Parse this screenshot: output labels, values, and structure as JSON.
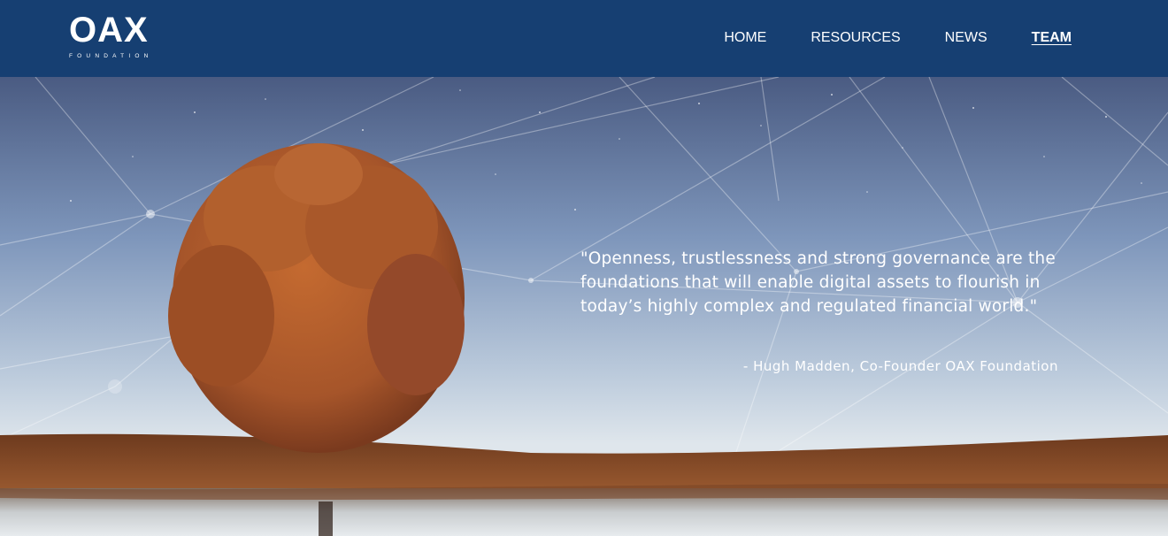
{
  "brand": {
    "logo_text": "OAX",
    "logo_subtext": "FOUNDATION"
  },
  "nav": {
    "items": [
      {
        "label": "HOME"
      },
      {
        "label": "RESOURCES"
      },
      {
        "label": "NEWS"
      },
      {
        "label": "TEAM",
        "active": true
      }
    ]
  },
  "hero": {
    "quote": "\"Openness, trustlessness and strong governance are the foundations that will enable digital assets to flourish in today’s highly complex and regulated financial world.\"",
    "attribution": "- Hugh Madden, Co-Founder OAX Foundation"
  },
  "colors": {
    "header_bg": "#163f72",
    "sky_top": "#4a5f86",
    "sky_mid": "#8ba4c5",
    "sky_low": "#d8e3ec",
    "ground": "#8a4a24",
    "tree_foliage": "#b5622e"
  }
}
